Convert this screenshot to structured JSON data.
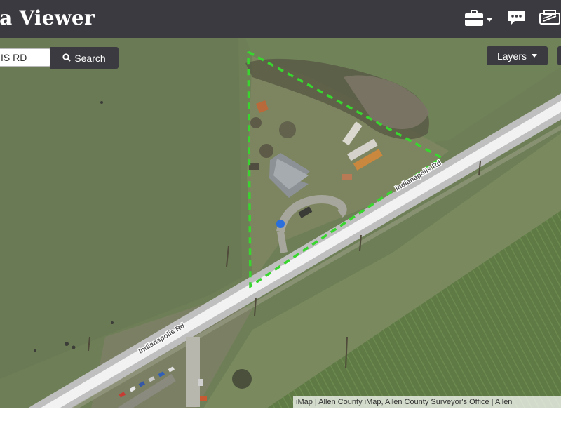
{
  "app": {
    "title": "ta Viewer"
  },
  "header": {
    "tools_icon": "briefcase-icon",
    "comments_icon": "speech-bubble-icon",
    "print_icon": "printer-icon"
  },
  "search": {
    "value": "IS RD",
    "button_label": "Search",
    "icon": "search-icon"
  },
  "layers": {
    "button_label": "Layers",
    "icon": "chevron-down-icon"
  },
  "map": {
    "road_labels": [
      "Indianapolis Rd",
      "Indianapolis Rd"
    ],
    "attribution": "iMap | Allen County iMap, Allen County Surveyor's Office | Allen",
    "parcel_outline_color": "#39d62f",
    "location_marker_color": "#2a6fdb"
  },
  "colors": {
    "header_bg": "#3a3a40",
    "button_bg": "#3a3a40",
    "text_light": "#ffffff"
  }
}
